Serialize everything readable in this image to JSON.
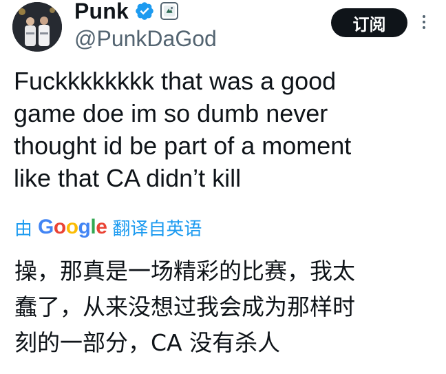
{
  "user": {
    "display_name": "Punk",
    "handle": "@PunkDaGod",
    "verified_icon": "verified-badge-icon",
    "affiliate_icon": "affiliate-badge-icon",
    "colors": {
      "verified": "#1d9bf0"
    }
  },
  "header": {
    "subscribe_label": "订阅",
    "more_icon": "more-options-icon"
  },
  "tweet": {
    "lines": [
      "Fuckkkkkkkk that was a good",
      "game doe im so dumb never",
      "thought id be part of a moment",
      "like that CA didn’t kill"
    ]
  },
  "translation": {
    "prefix": "由",
    "provider_letters": [
      "G",
      "o",
      "o",
      "g",
      "l",
      "e"
    ],
    "provider_colors": [
      "#4285f4",
      "#ea4335",
      "#fbbc05",
      "#4285f4",
      "#34a853",
      "#ea4335"
    ],
    "suffix": "翻译自英语",
    "lines": [
      "操，那真是一场精彩的比赛，我太",
      "蠢了，从来没想过我会成为那样时",
      "刻的一部分，CA 没有杀人"
    ],
    "link_color": "#1d9bf0"
  }
}
